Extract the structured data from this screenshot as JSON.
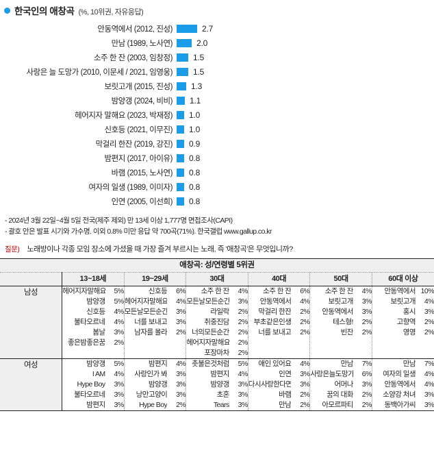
{
  "header": {
    "bullet_icon": "filled-circle-icon",
    "title": "한국인의 애창곡",
    "subtitle": "(%, 10위권, 자유응답)"
  },
  "chart_data": {
    "type": "bar",
    "title": "한국인의 애창곡 (%, 10위권, 자유응답)",
    "xlabel": "",
    "ylabel": "",
    "orientation": "horizontal",
    "grid": false,
    "legend": false,
    "xlim": [
      0,
      2.7
    ],
    "unit": "%",
    "bar_color": "#1b9ce8",
    "categories": [
      "안동역에서 (2012, 진성)",
      "만남 (1989, 노사연)",
      "소주 한 잔 (2003, 임창정)",
      "사랑은 늘 도망가 (2010, 이문세 / 2021, 임영웅)",
      "보릿고개 (2015, 진성)",
      "밤양갱 (2024, 비비)",
      "헤어지자 말해요 (2023, 박재정)",
      "신호등 (2021, 이무진)",
      "막걸리 한잔 (2019, 강진)",
      "밤편지 (2017, 아이유)",
      "바램 (2015, 노사연)",
      "여자의 일생 (1989, 이미자)",
      "인연 (2005, 이선희)"
    ],
    "values": [
      2.7,
      2.0,
      1.5,
      1.5,
      1.3,
      1.1,
      1.0,
      1.0,
      0.9,
      0.8,
      0.8,
      0.8,
      0.8
    ],
    "value_labels": [
      "2.7",
      "2.0",
      "1.5",
      "1.5",
      "1.3",
      "1.1",
      "1.0",
      "1.0",
      "0.9",
      "0.8",
      "0.8",
      "0.8",
      "0.8"
    ]
  },
  "footnotes": [
    "- 2024년 3월 22일~4월 5일 전국(제주 제외) 만 13세 이상 1,777명 면접조사(CAPI)",
    "- 괄호 안은 발표 시기와 가수명. 이외 0.8% 미만 응답 약 700곡(71%). 한국갤럽 www.gallup.co.kr"
  ],
  "question": {
    "tag": "질문)",
    "tag_color": "#c00000",
    "text": "노래방이나 각종 모임 장소에 가셨을 때 가장 즐겨 부르시는 노래, 즉 '애창곡'은 무엇입니까?"
  },
  "table": {
    "caption": "애창곡: 성/연령별 5위권",
    "corner_label": "",
    "columns": [
      "13~18세",
      "19~29세",
      "30대",
      "40대",
      "50대",
      "60대 이상"
    ],
    "rows": [
      {
        "gender": "남성",
        "cells": [
          [
            {
              "name": "헤어지자말해요",
              "pct": "5%"
            },
            {
              "name": "밤양갱",
              "pct": "5%"
            },
            {
              "name": "신호등",
              "pct": "4%"
            },
            {
              "name": "불타오르네",
              "pct": "4%"
            },
            {
              "name": "봄날",
              "pct": "3%"
            },
            {
              "name": "좋은밤좋은꿈",
              "pct": "2%"
            }
          ],
          [
            {
              "name": "신호등",
              "pct": "6%"
            },
            {
              "name": "헤어지자말해요",
              "pct": "4%"
            },
            {
              "name": "모든날모든순간",
              "pct": "3%"
            },
            {
              "name": "너를 보내고",
              "pct": "3%"
            },
            {
              "name": "남자를 몰라",
              "pct": "2%"
            }
          ],
          [
            {
              "name": "소주 한 잔",
              "pct": "4%"
            },
            {
              "name": "모든날모든순간",
              "pct": "3%"
            },
            {
              "name": "라일락",
              "pct": "2%"
            },
            {
              "name": "취중진담",
              "pct": "2%"
            },
            {
              "name": "너의모든순간",
              "pct": "2%"
            },
            {
              "name": "헤어지자말해요",
              "pct": "2%"
            },
            {
              "name": "포장마차",
              "pct": "2%"
            }
          ],
          [
            {
              "name": "소주 한 잔",
              "pct": "6%"
            },
            {
              "name": "안동역에서",
              "pct": "4%"
            },
            {
              "name": "막걸리 한잔",
              "pct": "2%"
            },
            {
              "name": "부초같은인생",
              "pct": "2%"
            },
            {
              "name": "너를 보내고",
              "pct": "2%"
            }
          ],
          [
            {
              "name": "소주 한 잔",
              "pct": "4%"
            },
            {
              "name": "보릿고개",
              "pct": "3%"
            },
            {
              "name": "안동역에서",
              "pct": "3%"
            },
            {
              "name": "테스형!",
              "pct": "2%"
            },
            {
              "name": "빈잔",
              "pct": "2%"
            }
          ],
          [
            {
              "name": "안동역에서",
              "pct": "10%"
            },
            {
              "name": "보릿고개",
              "pct": "4%"
            },
            {
              "name": "홍시",
              "pct": "3%"
            },
            {
              "name": "고향역",
              "pct": "2%"
            },
            {
              "name": "영영",
              "pct": "2%"
            }
          ]
        ]
      },
      {
        "gender": "여성",
        "cells": [
          [
            {
              "name": "밤양갱",
              "pct": "5%"
            },
            {
              "name": "I AM",
              "pct": "4%"
            },
            {
              "name": "Hype Boy",
              "pct": "3%"
            },
            {
              "name": "불타오르네",
              "pct": "3%"
            },
            {
              "name": "밤편지",
              "pct": "3%"
            }
          ],
          [
            {
              "name": "밤편지",
              "pct": "4%"
            },
            {
              "name": "사랑인가 봐",
              "pct": "3%"
            },
            {
              "name": "밤양갱",
              "pct": "3%"
            },
            {
              "name": "낭만고양이",
              "pct": "3%"
            },
            {
              "name": "Hype Boy",
              "pct": "2%"
            }
          ],
          [
            {
              "name": "촛불은것처럼",
              "pct": "5%"
            },
            {
              "name": "밤편지",
              "pct": "4%"
            },
            {
              "name": "밤양갱",
              "pct": "3%"
            },
            {
              "name": "초혼",
              "pct": "3%"
            },
            {
              "name": "Tears",
              "pct": "3%"
            }
          ],
          [
            {
              "name": "애인 있어요",
              "pct": "4%"
            },
            {
              "name": "인연",
              "pct": "3%"
            },
            {
              "name": "다시사랑한다면",
              "pct": "3%"
            },
            {
              "name": "바램",
              "pct": "2%"
            },
            {
              "name": "만남",
              "pct": "2%"
            }
          ],
          [
            {
              "name": "만남",
              "pct": "7%"
            },
            {
              "name": "사랑은늘도망가",
              "pct": "6%"
            },
            {
              "name": "어머나",
              "pct": "3%"
            },
            {
              "name": "꿈의 대화",
              "pct": "2%"
            },
            {
              "name": "아모르파티",
              "pct": "2%"
            }
          ],
          [
            {
              "name": "만남",
              "pct": "7%"
            },
            {
              "name": "여자의 일생",
              "pct": "4%"
            },
            {
              "name": "안동역에서",
              "pct": "4%"
            },
            {
              "name": "소양강 처녀",
              "pct": "3%"
            },
            {
              "name": "동백아가씨",
              "pct": "3%"
            }
          ]
        ]
      }
    ]
  }
}
